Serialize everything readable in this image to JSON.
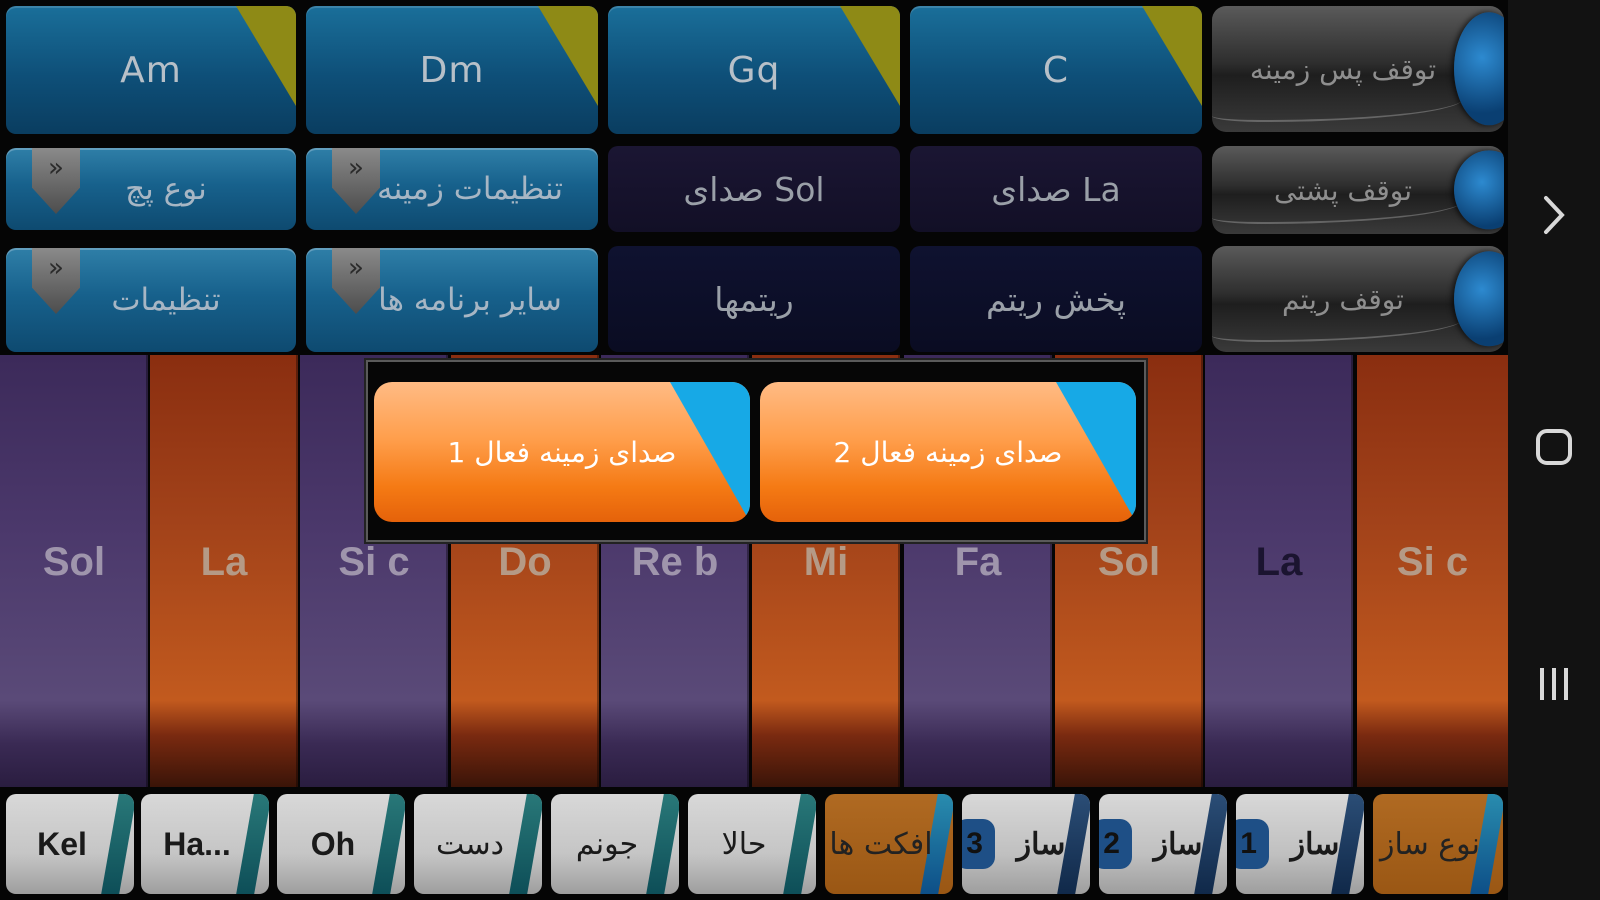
{
  "chords": [
    {
      "label": "Am"
    },
    {
      "label": "Dm"
    },
    {
      "label": "Gq"
    },
    {
      "label": "C"
    }
  ],
  "controls": {
    "stop_background": "توقف پس زمینه",
    "stop_backing": "توقف پشتی",
    "stop_rhythm": "توقف ریتم",
    "patch_type": "نوع پچ",
    "background_settings": "تنظیمات زمینه",
    "sound_sol": "صدای Sol",
    "sound_la": "صدای La",
    "settings": "تنظیمات",
    "other_apps": "سایر برنامه ها",
    "rhythms": "ریتمها",
    "play_rhythm": "پخش ریتم"
  },
  "keys": [
    {
      "label": "Sol"
    },
    {
      "label": "La"
    },
    {
      "label": "Si c"
    },
    {
      "label": "Do"
    },
    {
      "label": "Re b"
    },
    {
      "label": "Mi"
    },
    {
      "label": "Fa"
    },
    {
      "label": "Sol"
    },
    {
      "label": "La"
    },
    {
      "label": "Si c"
    }
  ],
  "popup": {
    "active_bg_1": "صدای زمینه فعال 1",
    "active_bg_2": "صدای زمینه فعال 2"
  },
  "bottom": {
    "kel": "Kel",
    "ha": "Ha...",
    "oh": "Oh",
    "dast": "دست",
    "jonam": "جونم",
    "hala": "حالا",
    "effects": "افکت ها",
    "saz_label": "ساز",
    "saz3": "3",
    "saz2": "2",
    "saz1": "1",
    "instrument_type": "نوع ساز"
  },
  "colors": {
    "chord_blue": "#0e4f78",
    "chord_corner": "#8e8a16",
    "orange": "#f57a14",
    "popup_corner": "#17a9e6"
  }
}
